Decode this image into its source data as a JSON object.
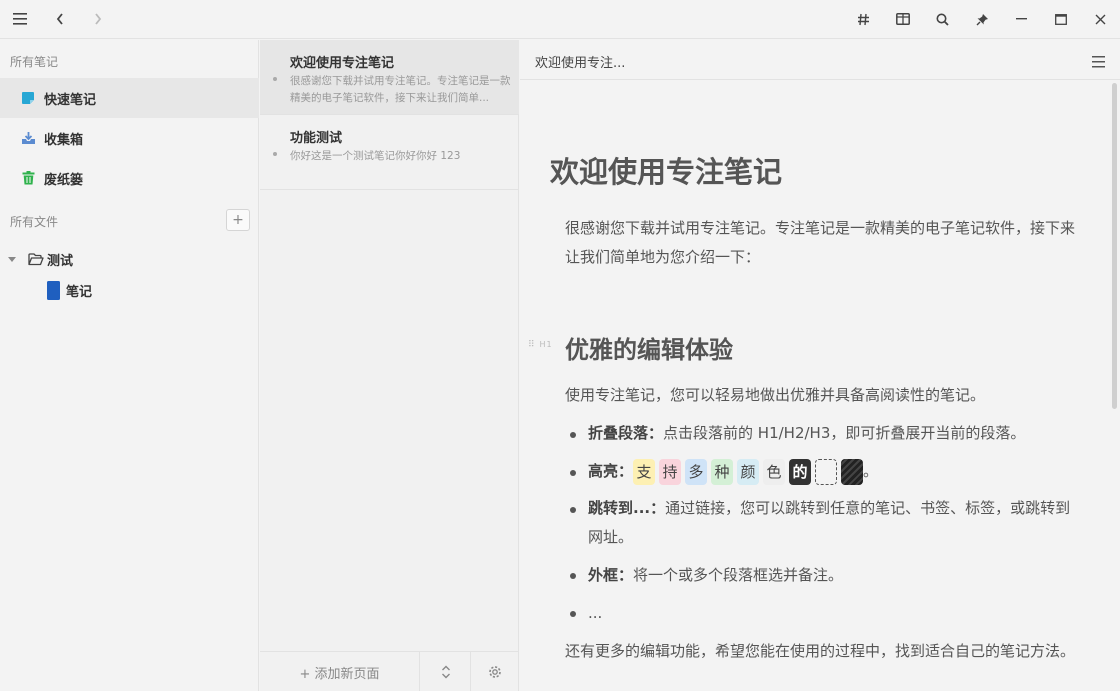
{
  "sidebar": {
    "all_notes_label": "所有笔记",
    "nav": [
      {
        "label": "快速笔记",
        "icon": "quick-note-icon",
        "color": "#27a7d4"
      },
      {
        "label": "收集箱",
        "icon": "inbox-icon",
        "color": "#5b8bd0"
      },
      {
        "label": "废纸篓",
        "icon": "trash-icon",
        "color": "#2fb24c"
      }
    ],
    "all_files_label": "所有文件",
    "add_label": "+",
    "tree": {
      "folder": "测试",
      "notebook": "笔记",
      "notebook_color": "#1f5fbf"
    }
  },
  "notelist": {
    "notes": [
      {
        "title": "欢迎使用专注笔记",
        "snippet": "很感谢您下载并试用专注笔记。专注笔记是一款精美的电子笔记软件，接下来让我们简单..."
      },
      {
        "title": "功能测试",
        "snippet": "你好这是一个测试笔记你好你好 123"
      }
    ],
    "add_page_label": "+ 添加新页面"
  },
  "editor": {
    "header_title": "欢迎使用专注...",
    "h1": "欢迎使用专注笔记",
    "intro": "很感谢您下载并试用专注笔记。专注笔记是一款精美的电子笔记软件，接下来让我们简单地为您介绍一下：",
    "h2_marker": "H1",
    "h2": "优雅的编辑体验",
    "p2": "使用专注笔记，您可以轻易地做出优雅并具备高阅读性的笔记。",
    "items": [
      {
        "bold": "折叠段落：",
        "text": "点击段落前的 H1/H2/H3，即可折叠展开当前的段落。"
      },
      {
        "bold": "",
        "text": "高亮："
      },
      {
        "bold": "跳转到...：",
        "text": "通过链接，您可以跳转到任意的笔记、书签、标签，或跳转到网址。"
      },
      {
        "bold": "外框：",
        "text": "将一个或多个段落框选并备注。"
      },
      {
        "bold": "",
        "text": "..."
      }
    ],
    "highlights": [
      {
        "char": "支",
        "bg": "#fdf0b3",
        "fg": "#444"
      },
      {
        "char": "持",
        "bg": "#f9d4dc",
        "fg": "#444"
      },
      {
        "char": "多",
        "bg": "#cfe3f7",
        "fg": "#444"
      },
      {
        "char": "种",
        "bg": "#d4f0d6",
        "fg": "#444"
      },
      {
        "char": "颜",
        "bg": "#d6ecf4",
        "fg": "#444"
      },
      {
        "char": "色",
        "bg": "#eeeeee",
        "fg": "#444"
      },
      {
        "char": "的",
        "bg": "#333333",
        "fg": "#ffffff"
      }
    ],
    "highlight_end": "。",
    "p3": "还有更多的编辑功能，希望您能在使用的过程中，找到适合自己的笔记方法。"
  }
}
